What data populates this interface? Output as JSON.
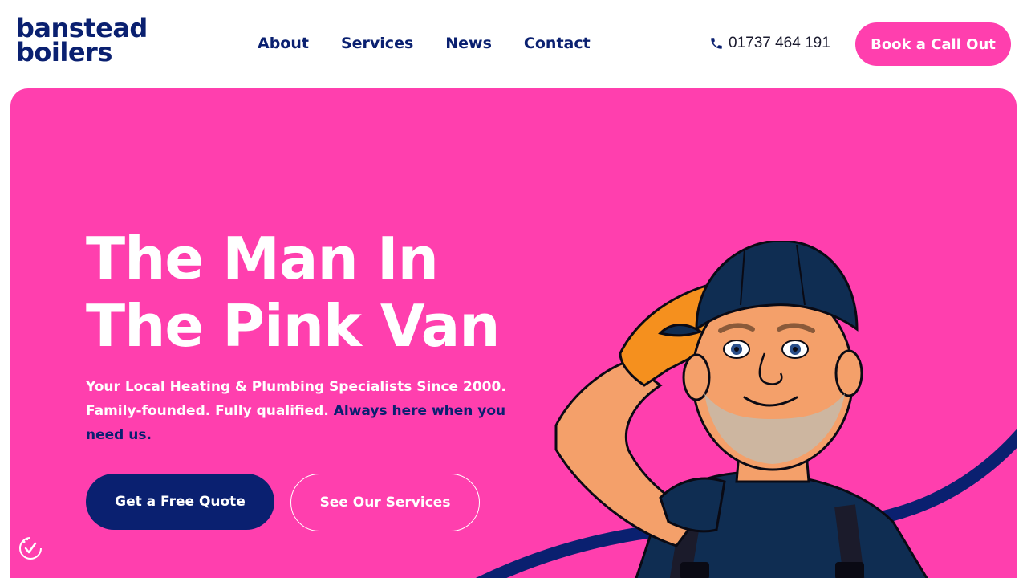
{
  "logo": {
    "line1": "banstead",
    "line2": "boilers"
  },
  "nav": {
    "items": [
      {
        "label": "About"
      },
      {
        "label": "Services"
      },
      {
        "label": "News"
      },
      {
        "label": "Contact"
      }
    ]
  },
  "header": {
    "phone": "01737 464 191",
    "phone_icon": "phone-icon",
    "cta_label": "Book a Call Out"
  },
  "hero": {
    "title_line1": "The Man In",
    "title_line2": "The Pink Van",
    "subtitle_part1": "Your Local Heating & Plumbing Specialists Since 2000. Family-founded. Fully qualified. ",
    "subtitle_accent": "Always here when you need us.",
    "primary_button": "Get a Free Quote",
    "secondary_button": "See Our Services"
  },
  "colors": {
    "brand_pink": "#ff3fae",
    "brand_navy": "#0a2070",
    "white": "#ffffff"
  },
  "icons": {
    "consent": "cookie-consent-icon",
    "mascot": "saluting-plumber-mascot"
  }
}
